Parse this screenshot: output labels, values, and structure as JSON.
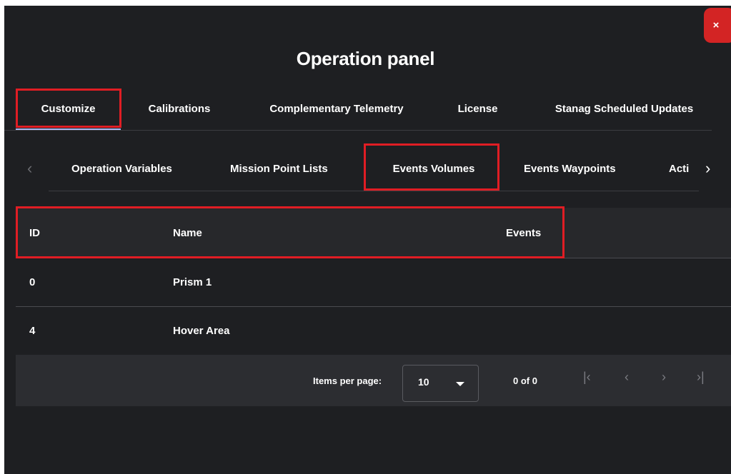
{
  "dialog": {
    "title": "Operation panel",
    "close_label": "×"
  },
  "main_tabs": [
    {
      "label": "Customize",
      "active": true
    },
    {
      "label": "Calibrations"
    },
    {
      "label": "Complementary Telemetry"
    },
    {
      "label": "License"
    },
    {
      "label": "Stanag Scheduled Updates"
    }
  ],
  "sub_tabs": {
    "prev_icon": "‹",
    "next_icon": "›",
    "items": [
      {
        "label": "Operation Variables"
      },
      {
        "label": "Mission Point Lists"
      },
      {
        "label": "Events Volumes",
        "active": true
      },
      {
        "label": "Events Waypoints"
      },
      {
        "label": "Acti"
      }
    ]
  },
  "table": {
    "columns": [
      "ID",
      "Name",
      "Events"
    ],
    "rows": [
      {
        "id": "0",
        "name": "Prism 1",
        "events": ""
      },
      {
        "id": "4",
        "name": "Hover Area",
        "events": ""
      }
    ]
  },
  "paginator": {
    "items_per_page_label": "Items per page:",
    "page_size": "10",
    "range_label": "0 of 0",
    "first_icon": "|‹",
    "prev_icon": "‹",
    "next_icon": "›",
    "last_icon": "›|"
  },
  "colors": {
    "background": "#1e1f22",
    "header_bg": "#27282b",
    "paginator_bg": "#2c2d31",
    "close_button": "#d32424",
    "highlight": "#e01d24",
    "active_tab_underline": "#aab6f0"
  }
}
